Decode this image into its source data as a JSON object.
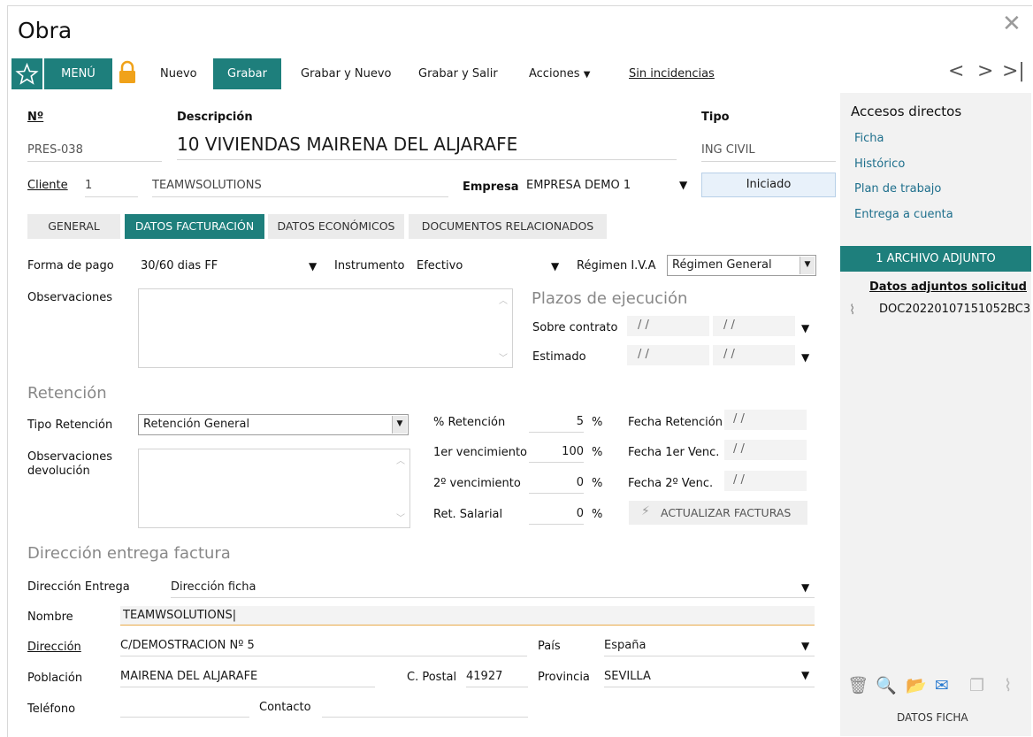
{
  "window": {
    "title": "Obra"
  },
  "toolbar": {
    "menu": "MENÚ",
    "nuevo": "Nuevo",
    "grabar": "Grabar",
    "grabar_nuevo": "Grabar y Nuevo",
    "grabar_salir": "Grabar y Salir",
    "acciones": "Acciones",
    "incidencias": "Sin incidencias"
  },
  "header": {
    "num_label": "Nº",
    "num_value": "PRES-038",
    "desc_label": "Descripción",
    "desc_value": "10 VIVIENDAS MAIRENA DEL ALJARAFE",
    "tipo_label": "Tipo",
    "tipo_value": "ING CIVIL",
    "cliente_label": "Cliente",
    "cliente_id": "1",
    "cliente_name": "TEAMWSOLUTIONS",
    "empresa_label": "Empresa",
    "empresa_value": "EMPRESA DEMO 1",
    "estado": "Iniciado"
  },
  "tabs": [
    "GENERAL",
    "DATOS FACTURACIÓN",
    "DATOS ECONÓMICOS",
    "DOCUMENTOS RELACIONADOS"
  ],
  "billing": {
    "forma_pago_label": "Forma de pago",
    "forma_pago_value": "30/60 dias FF",
    "instrumento_label": "Instrumento",
    "instrumento_value": "Efectivo",
    "regimen_label": "Régimen I.V.A",
    "regimen_value": "Régimen General",
    "observaciones_label": "Observaciones",
    "plazos_title": "Plazos de ejecución",
    "sobre_contrato_label": "Sobre contrato",
    "estimado_label": "Estimado",
    "date_placeholder": "/ /"
  },
  "retention": {
    "title": "Retención",
    "tipo_label": "Tipo Retención",
    "tipo_value": "Retención General",
    "obs_dev_label_1": "Observaciones",
    "obs_dev_label_2": "devolución",
    "pct_ret_label": "% Retención",
    "pct_ret_value": "5",
    "venc1_label": "1er vencimiento",
    "venc1_value": "100",
    "venc2_label": "2º vencimiento",
    "venc2_value": "0",
    "ret_sal_label": "Ret. Salarial",
    "ret_sal_value": "0",
    "pct": "%",
    "fecha_ret_label": "Fecha Retención",
    "fecha_venc1_label": "Fecha 1er Venc.",
    "fecha_venc2_label": "Fecha 2º Venc.",
    "date_placeholder": "/ /",
    "actualizar": "ACTUALIZAR FACTURAS"
  },
  "address": {
    "title": "Dirección entrega factura",
    "dir_entrega_label": "Dirección Entrega",
    "dir_entrega_value": "Dirección ficha",
    "nombre_label": "Nombre",
    "nombre_value": "TEAMWSOLUTIONS",
    "direccion_label": "Dirección",
    "direccion_value": "C/DEMOSTRACION Nº 5",
    "pais_label": "País",
    "pais_value": "España",
    "poblacion_label": "Población",
    "poblacion_value": "MAIRENA DEL ALJARAFE",
    "cp_label": "C. Postal",
    "cp_value": "41927",
    "provincia_label": "Provincia",
    "provincia_value": "SEVILLA",
    "telefono_label": "Teléfono",
    "contacto_label": "Contacto"
  },
  "sidebar": {
    "accesos_title": "Accesos directos",
    "links": [
      "Ficha",
      "Histórico",
      "Plan de trabajo",
      "Entrega a cuenta"
    ],
    "attachments_header": "1 ARCHIVO ADJUNTO",
    "attachments_subtitle": "Datos adjuntos solicitud",
    "attachment_file": "DOC20220107151052BC3",
    "footer": "DATOS FICHA"
  },
  "colors": {
    "accent": "#1e7f7c",
    "link": "#1e6f8c",
    "lock": "#f0a21a"
  }
}
